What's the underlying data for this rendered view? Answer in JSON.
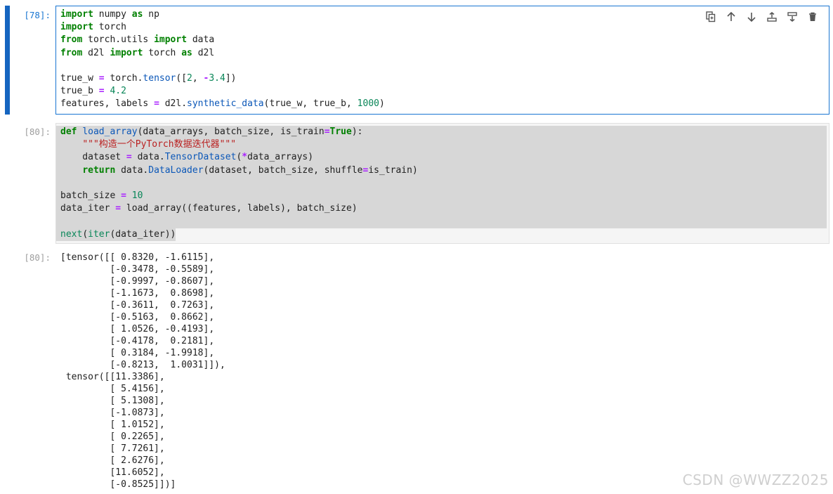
{
  "cells": [
    {
      "prompt": "[78]:",
      "lines": [
        [
          [
            "kw",
            "import"
          ],
          [
            "nm",
            " numpy "
          ],
          [
            "kw",
            "as"
          ],
          [
            "nm",
            " np"
          ]
        ],
        [
          [
            "kw",
            "import"
          ],
          [
            "nm",
            " torch"
          ]
        ],
        [
          [
            "kw",
            "from"
          ],
          [
            "nm",
            " torch.utils "
          ],
          [
            "kw",
            "import"
          ],
          [
            "nm",
            " data"
          ]
        ],
        [
          [
            "kw",
            "from"
          ],
          [
            "nm",
            " d2l "
          ],
          [
            "kw",
            "import"
          ],
          [
            "nm",
            " torch "
          ],
          [
            "kw",
            "as"
          ],
          [
            "nm",
            " d2l"
          ]
        ],
        [],
        [
          [
            "nm",
            "true_w "
          ],
          [
            "op",
            "="
          ],
          [
            "nm",
            " torch."
          ],
          [
            "fn",
            "tensor"
          ],
          [
            "br",
            "(["
          ],
          [
            "num",
            "2"
          ],
          [
            "nm",
            ", "
          ],
          [
            "op",
            "-"
          ],
          [
            "num",
            "3.4"
          ],
          [
            "br",
            "])"
          ]
        ],
        [
          [
            "nm",
            "true_b "
          ],
          [
            "op",
            "="
          ],
          [
            "nm",
            " "
          ],
          [
            "num",
            "4.2"
          ]
        ],
        [
          [
            "nm",
            "features, labels "
          ],
          [
            "op",
            "="
          ],
          [
            "nm",
            " d2l."
          ],
          [
            "fn",
            "synthetic_data"
          ],
          [
            "br",
            "("
          ],
          [
            "nm",
            "true_w, true_b, "
          ],
          [
            "num",
            "1000"
          ],
          [
            "br",
            ")"
          ]
        ]
      ]
    },
    {
      "prompt": "[80]:",
      "lines": [
        [
          [
            "kw",
            "def"
          ],
          [
            "nm",
            " "
          ],
          [
            "fn",
            "load_array"
          ],
          [
            "br",
            "("
          ],
          [
            "nm",
            "data_arrays, batch_size, is_train"
          ],
          [
            "op",
            "="
          ],
          [
            "kw",
            "True"
          ],
          [
            "br",
            "):"
          ]
        ],
        [
          [
            "nm",
            "    "
          ],
          [
            "str",
            "\"\"\"构造一个PyTorch数据迭代器\"\"\""
          ]
        ],
        [
          [
            "nm",
            "    dataset "
          ],
          [
            "op",
            "="
          ],
          [
            "nm",
            " data."
          ],
          [
            "fn",
            "TensorDataset"
          ],
          [
            "br",
            "("
          ],
          [
            "op",
            "*"
          ],
          [
            "nm",
            "data_arrays"
          ],
          [
            "br",
            ")"
          ]
        ],
        [
          [
            "nm",
            "    "
          ],
          [
            "kw",
            "return"
          ],
          [
            "nm",
            " data."
          ],
          [
            "fn",
            "DataLoader"
          ],
          [
            "br",
            "("
          ],
          [
            "nm",
            "dataset, batch_size, shuffle"
          ],
          [
            "op",
            "="
          ],
          [
            "nm",
            "is_train"
          ],
          [
            "br",
            ")"
          ]
        ],
        [],
        [
          [
            "nm",
            "batch_size "
          ],
          [
            "op",
            "="
          ],
          [
            "nm",
            " "
          ],
          [
            "num",
            "10"
          ]
        ],
        [
          [
            "nm",
            "data_iter "
          ],
          [
            "op",
            "="
          ],
          [
            "nm",
            " load_array((features, labels), batch_size)"
          ]
        ],
        [],
        [
          [
            "num",
            "next"
          ],
          [
            "br",
            "("
          ],
          [
            "num",
            "iter"
          ],
          [
            "br",
            "("
          ],
          [
            "nm",
            "data_iter"
          ],
          [
            "br",
            "))"
          ]
        ]
      ]
    }
  ],
  "output": {
    "prompt": "[80]:",
    "text": "[tensor([[ 0.8320, -1.6115],\n         [-0.3478, -0.5589],\n         [-0.9997, -0.8607],\n         [-1.1673,  0.8698],\n         [-0.3611,  0.7263],\n         [-0.5163,  0.8662],\n         [ 1.0526, -0.4193],\n         [-0.4178,  0.2181],\n         [ 0.3184, -1.9918],\n         [-0.8213,  1.0031]]),\n tensor([[11.3386],\n         [ 5.4156],\n         [ 5.1308],\n         [-1.0873],\n         [ 1.0152],\n         [ 0.2265],\n         [ 7.7261],\n         [ 2.6276],\n         [11.6052],\n         [-0.8525]])]"
  },
  "toolbar": [
    "duplicate-icon",
    "move-up-icon",
    "move-down-icon",
    "insert-above-icon",
    "insert-below-icon",
    "delete-icon"
  ],
  "watermark": "CSDN @WWZZ2025",
  "colors": {
    "active": "#1565c0",
    "keyword": "#008000",
    "function": "#0b57b8",
    "number": "#098658",
    "operator": "#aa22ff",
    "string": "#ba2121"
  }
}
